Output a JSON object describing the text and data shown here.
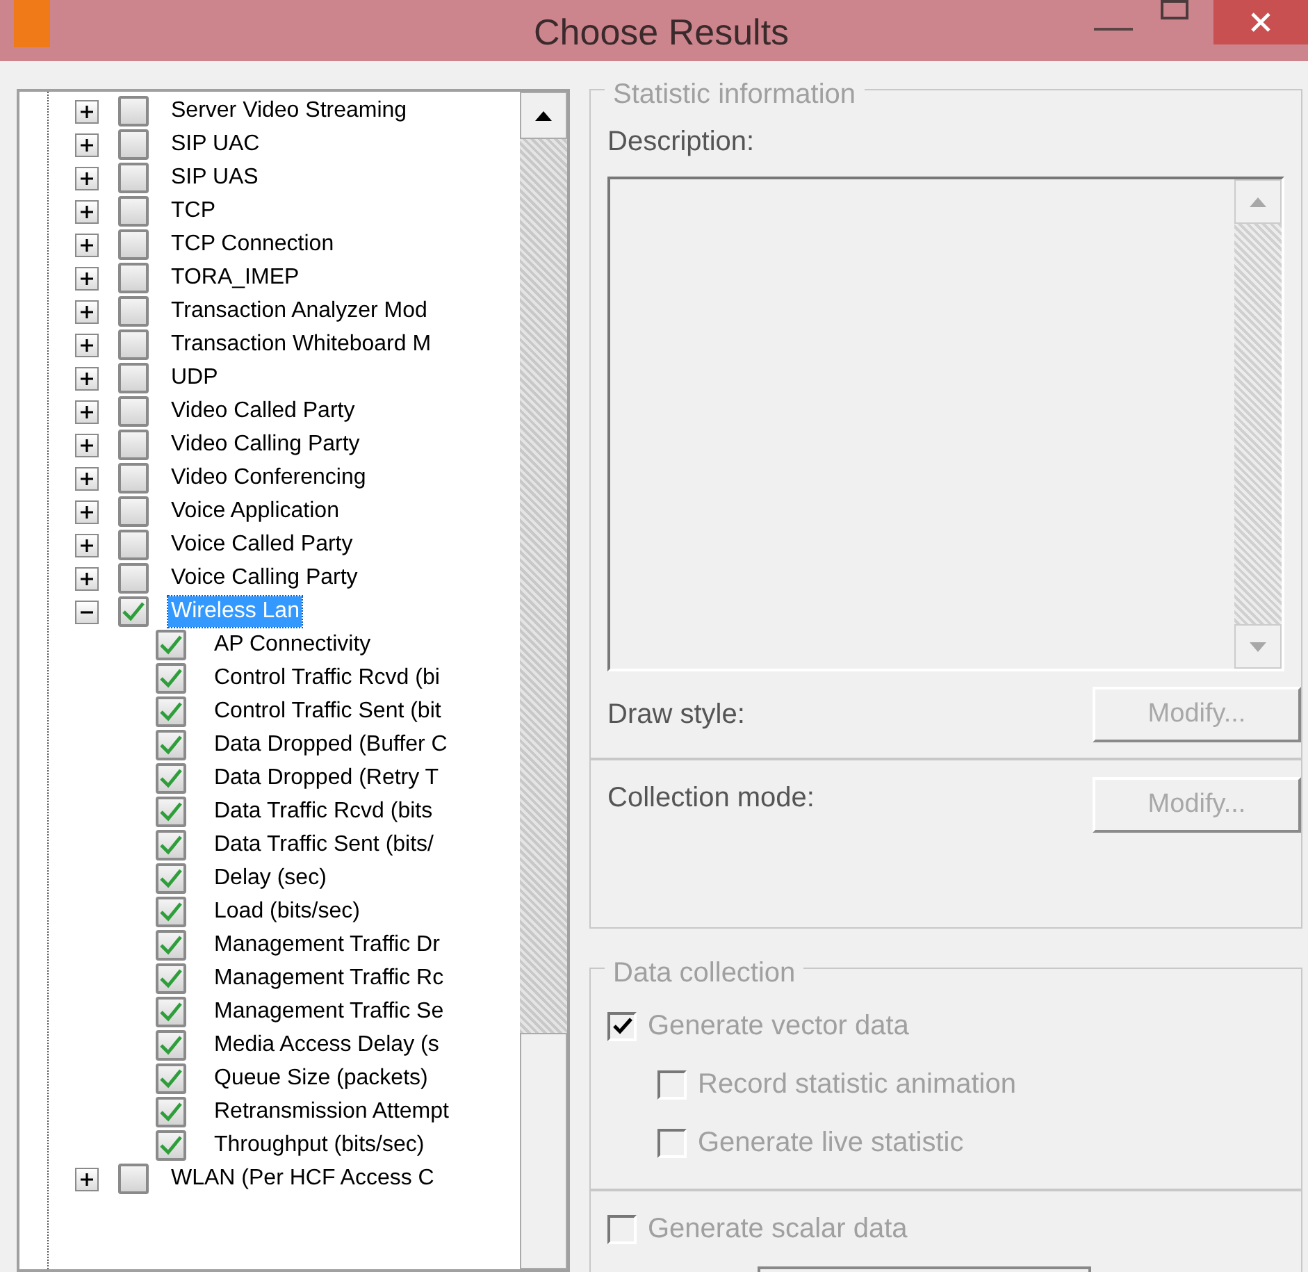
{
  "window": {
    "title": "Choose Results"
  },
  "tree": {
    "items": [
      {
        "label": "Server Video Streaming",
        "expanded": false,
        "checked": false,
        "selected": false
      },
      {
        "label": "SIP UAC",
        "expanded": false,
        "checked": false,
        "selected": false
      },
      {
        "label": "SIP UAS",
        "expanded": false,
        "checked": false,
        "selected": false
      },
      {
        "label": "TCP",
        "expanded": false,
        "checked": false,
        "selected": false
      },
      {
        "label": "TCP Connection",
        "expanded": false,
        "checked": false,
        "selected": false
      },
      {
        "label": "TORA_IMEP",
        "expanded": false,
        "checked": false,
        "selected": false
      },
      {
        "label": "Transaction Analyzer Mod",
        "expanded": false,
        "checked": false,
        "selected": false
      },
      {
        "label": "Transaction Whiteboard M",
        "expanded": false,
        "checked": false,
        "selected": false
      },
      {
        "label": "UDP",
        "expanded": false,
        "checked": false,
        "selected": false
      },
      {
        "label": "Video Called Party",
        "expanded": false,
        "checked": false,
        "selected": false
      },
      {
        "label": "Video Calling Party",
        "expanded": false,
        "checked": false,
        "selected": false
      },
      {
        "label": "Video Conferencing",
        "expanded": false,
        "checked": false,
        "selected": false
      },
      {
        "label": "Voice Application",
        "expanded": false,
        "checked": false,
        "selected": false
      },
      {
        "label": "Voice Called Party",
        "expanded": false,
        "checked": false,
        "selected": false
      },
      {
        "label": "Voice Calling Party",
        "expanded": false,
        "checked": false,
        "selected": false
      },
      {
        "label": "Wireless Lan",
        "expanded": true,
        "checked": true,
        "selected": true,
        "children": [
          {
            "label": "AP Connectivity",
            "checked": true,
            "selected": false
          },
          {
            "label": "Control Traffic Rcvd (bi",
            "checked": true,
            "selected": false
          },
          {
            "label": "Control Traffic Sent (bit",
            "checked": true,
            "selected": false
          },
          {
            "label": "Data Dropped (Buffer C",
            "checked": true,
            "selected": false
          },
          {
            "label": "Data Dropped (Retry T",
            "checked": true,
            "selected": false
          },
          {
            "label": "Data Traffic Rcvd (bits",
            "checked": true,
            "selected": false
          },
          {
            "label": "Data Traffic Sent (bits/",
            "checked": true,
            "selected": false
          },
          {
            "label": "Delay (sec)",
            "checked": true,
            "selected": false
          },
          {
            "label": "Load (bits/sec)",
            "checked": true,
            "selected": false
          },
          {
            "label": "Management Traffic Dr",
            "checked": true,
            "selected": false
          },
          {
            "label": "Management Traffic Rc",
            "checked": true,
            "selected": false
          },
          {
            "label": "Management Traffic Se",
            "checked": true,
            "selected": false
          },
          {
            "label": "Media Access Delay (s",
            "checked": true,
            "selected": false
          },
          {
            "label": "Queue Size (packets)",
            "checked": true,
            "selected": false
          },
          {
            "label": "Retransmission Attempt",
            "checked": true,
            "selected": false
          },
          {
            "label": "Throughput (bits/sec)",
            "checked": true,
            "selected": false
          }
        ]
      },
      {
        "label": "WLAN (Per HCF Access C",
        "expanded": false,
        "checked": false,
        "selected": false
      }
    ]
  },
  "statistic_information": {
    "title": "Statistic information",
    "description_label": "Description:",
    "draw_style": {
      "label": "Draw style:",
      "button": {
        "label": "Modify...",
        "disabled": true
      }
    },
    "collection_mode": {
      "label": "Collection mode:",
      "button": {
        "label": "Modify...",
        "disabled": true
      }
    }
  },
  "data_collection": {
    "title": "Data collection",
    "options": [
      {
        "label": "Generate vector data",
        "checked": true,
        "disabled": true,
        "children": [
          {
            "label": "Record statistic animation",
            "checked": false,
            "disabled": true
          },
          {
            "label": "Generate live statistic",
            "checked": false,
            "disabled": true
          }
        ]
      }
    ],
    "scalar": {
      "label": "Generate scalar data",
      "checked": false,
      "disabled": true
    }
  }
}
